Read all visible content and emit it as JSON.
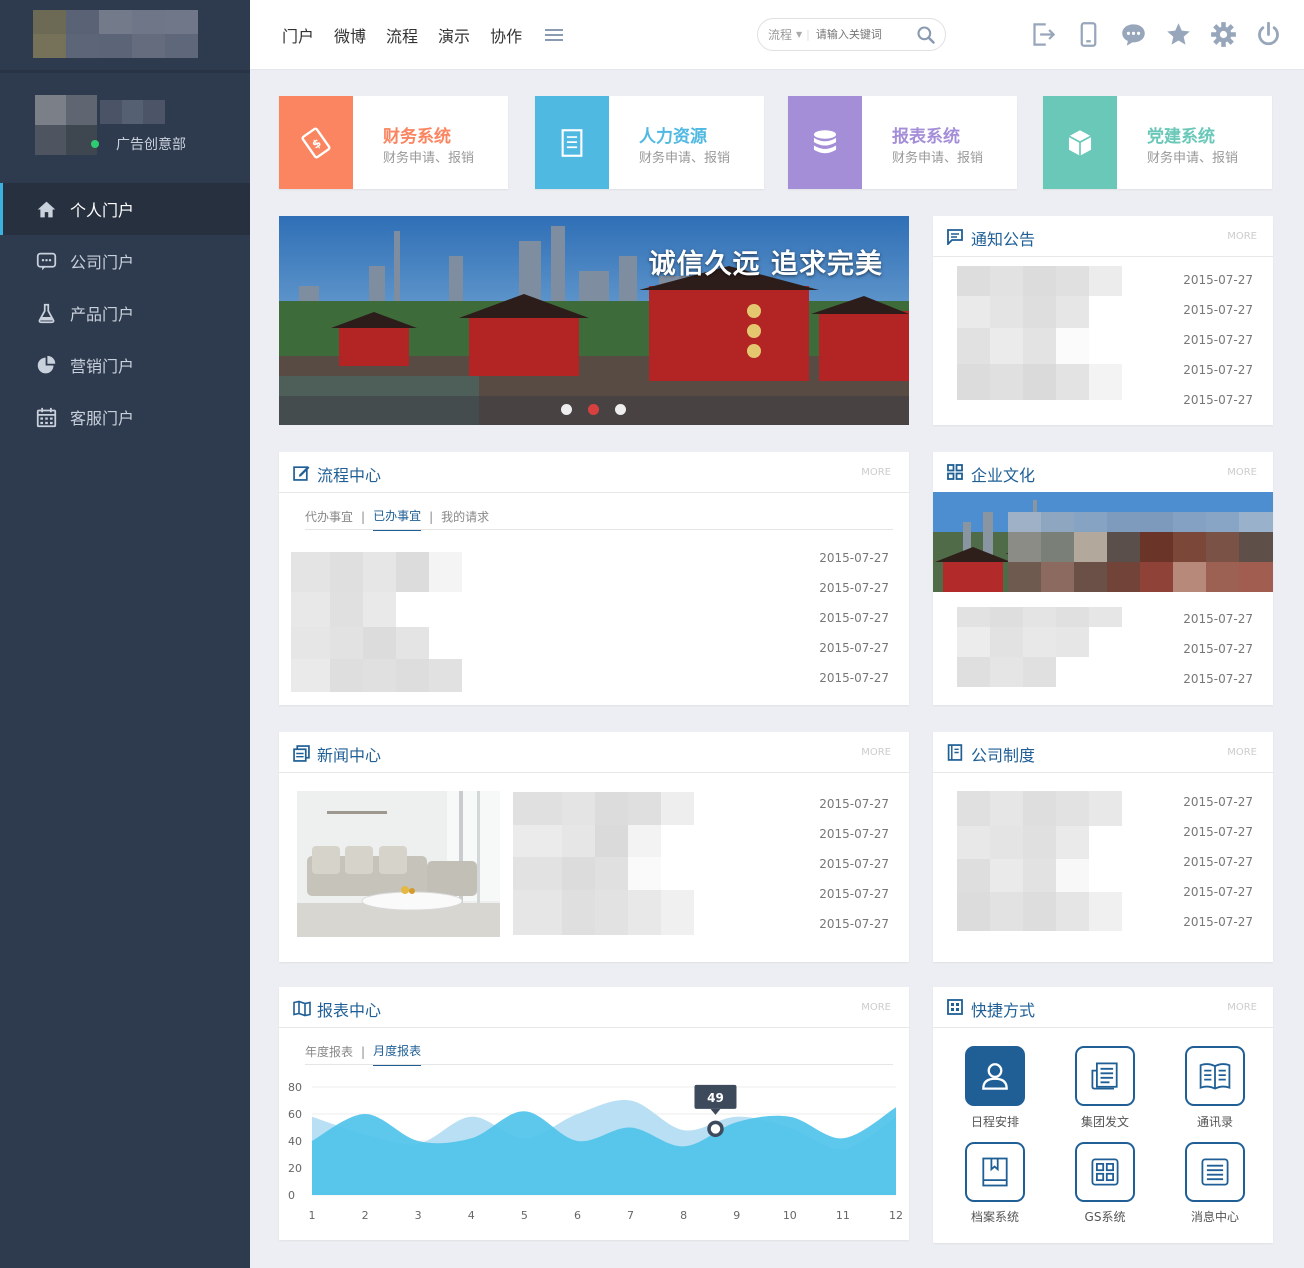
{
  "sidebar": {
    "user": {
      "department": "广告创意部"
    },
    "nav": [
      {
        "label": "个人门户",
        "icon": "home-icon",
        "active": true
      },
      {
        "label": "公司门户",
        "icon": "chat-icon"
      },
      {
        "label": "产品门户",
        "icon": "flask-icon"
      },
      {
        "label": "营销门户",
        "icon": "pie-chart-icon"
      },
      {
        "label": "客服门户",
        "icon": "calendar-icon"
      }
    ]
  },
  "topbar": {
    "nav": [
      "门户",
      "微博",
      "流程",
      "演示",
      "协作"
    ],
    "search": {
      "scope": "流程",
      "placeholder": "请输入关键词"
    },
    "tools": [
      "logout-icon",
      "mobile-icon",
      "message-icon",
      "star-icon",
      "gear-icon",
      "power-icon"
    ]
  },
  "tiles": [
    {
      "title": "财务系统",
      "subtitle": "财务申请、报销",
      "color": "#fa8560",
      "icon": "finance-ticket-icon"
    },
    {
      "title": "人力资源",
      "subtitle": "财务申请、报销",
      "color": "#4fb9e2",
      "icon": "document-icon"
    },
    {
      "title": "报表系统",
      "subtitle": "财务申请、报销",
      "color": "#a58ed8",
      "icon": "database-icon"
    },
    {
      "title": "党建系统",
      "subtitle": "财务申请、报销",
      "color": "#6ac8b9",
      "icon": "cube-icon"
    }
  ],
  "banner": {
    "caption": "诚信久远 追求完美"
  },
  "more_label": "MORE",
  "panels": {
    "notice": {
      "title": "通知公告",
      "dates": [
        "2015-07-27",
        "2015-07-27",
        "2015-07-27",
        "2015-07-27",
        "2015-07-27"
      ]
    },
    "workflow": {
      "title": "流程中心",
      "tabs": [
        "代办事宜",
        "已办事宜",
        "我的请求"
      ],
      "active_tab": 1,
      "dates": [
        "2015-07-27",
        "2015-07-27",
        "2015-07-27",
        "2015-07-27",
        "2015-07-27"
      ]
    },
    "culture": {
      "title": "企业文化",
      "dates": [
        "2015-07-27",
        "2015-07-27",
        "2015-07-27"
      ]
    },
    "news": {
      "title": "新闻中心",
      "dates": [
        "2015-07-27",
        "2015-07-27",
        "2015-07-27",
        "2015-07-27",
        "2015-07-27"
      ]
    },
    "policy": {
      "title": "公司制度",
      "dates": [
        "2015-07-27",
        "2015-07-27",
        "2015-07-27",
        "2015-07-27",
        "2015-07-27"
      ]
    },
    "report": {
      "title": "报表中心",
      "tabs": [
        "年度报表",
        "月度报表"
      ],
      "active_tab": 1
    },
    "shortcuts": {
      "title": "快捷方式",
      "items": [
        {
          "label": "日程安排",
          "icon": "user-icon",
          "active": true
        },
        {
          "label": "集团发文",
          "icon": "newspaper-icon"
        },
        {
          "label": "通讯录",
          "icon": "book-open-icon"
        },
        {
          "label": "档案系统",
          "icon": "archive-book-icon"
        },
        {
          "label": "GS系统",
          "icon": "grid-icon"
        },
        {
          "label": "消息中心",
          "icon": "list-icon"
        }
      ]
    }
  },
  "chart_data": {
    "type": "area",
    "x": [
      1,
      2,
      3,
      4,
      5,
      6,
      7,
      8,
      9,
      10,
      11,
      12
    ],
    "xlim": [
      1,
      12
    ],
    "ylim": [
      0,
      80
    ],
    "yticks": [
      0,
      20,
      40,
      60,
      80
    ],
    "series": [
      {
        "values": [
          58,
          45,
          38,
          58,
          42,
          60,
          70,
          48,
          58,
          50,
          34,
          58
        ],
        "color": "#b8dff3"
      },
      {
        "values": [
          40,
          60,
          40,
          42,
          62,
          40,
          50,
          36,
          54,
          58,
          42,
          65
        ],
        "color": "#4fc3ea"
      }
    ],
    "tooltip": {
      "x": 8.6,
      "value": 49
    },
    "grid": true
  }
}
